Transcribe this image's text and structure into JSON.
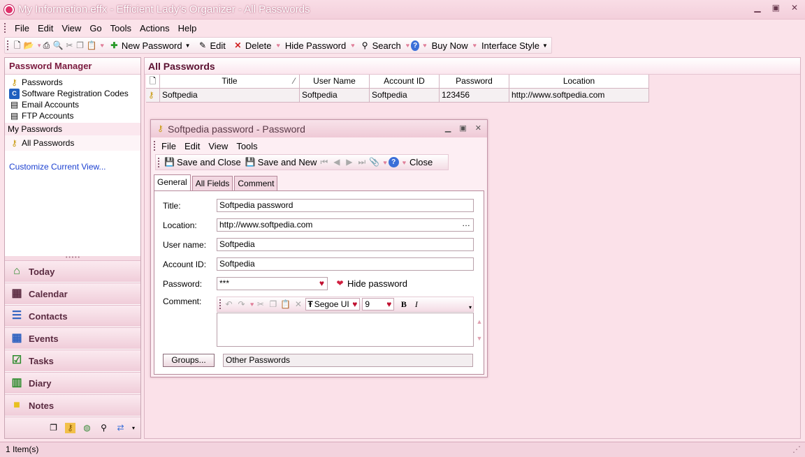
{
  "window": {
    "title": "My Information.effx - Efficient Lady's Organizer - All Passwords"
  },
  "menu": [
    "File",
    "Edit",
    "View",
    "Go",
    "Tools",
    "Actions",
    "Help"
  ],
  "toolbar": {
    "new_password": "New Password",
    "edit": "Edit",
    "delete": "Delete",
    "hide_password": "Hide Password",
    "search": "Search",
    "buy_now": "Buy Now",
    "interface_style": "Interface Style"
  },
  "sidebar": {
    "title": "Password Manager",
    "items": [
      "Passwords",
      "Software Registration Codes",
      "Email Accounts",
      "FTP Accounts"
    ],
    "section": "My Passwords",
    "section_items": [
      "All Passwords"
    ],
    "customize": "Customize Current View...",
    "nav": [
      "Today",
      "Calendar",
      "Contacts",
      "Events",
      "Tasks",
      "Diary",
      "Notes"
    ]
  },
  "main": {
    "title": "All Passwords",
    "columns": [
      "Title",
      "User Name",
      "Account ID",
      "Password",
      "Location"
    ],
    "rows": [
      [
        "Softpedia",
        "Softpedia",
        "Softpedia",
        "123456",
        "http://www.softpedia.com"
      ]
    ]
  },
  "dialog": {
    "title": "Softpedia password - Password",
    "menu": [
      "File",
      "Edit",
      "View",
      "Tools"
    ],
    "save_close": "Save and Close",
    "save_new": "Save and New",
    "close": "Close",
    "tabs": [
      "General",
      "All Fields",
      "Comment"
    ],
    "labels": {
      "title": "Title:",
      "location": "Location:",
      "username": "User name:",
      "account": "Account ID:",
      "password": "Password:",
      "comment": "Comment:"
    },
    "values": {
      "title": "Softpedia password",
      "location": "http://www.softpedia.com",
      "username": "Softpedia",
      "account": "Softpedia",
      "password": "***"
    },
    "hide_password": "Hide password",
    "font": "Segoe UI",
    "font_size": "9",
    "groups_button": "Groups...",
    "groups_value": "Other Passwords"
  },
  "status": {
    "items": "1 Item(s)"
  }
}
